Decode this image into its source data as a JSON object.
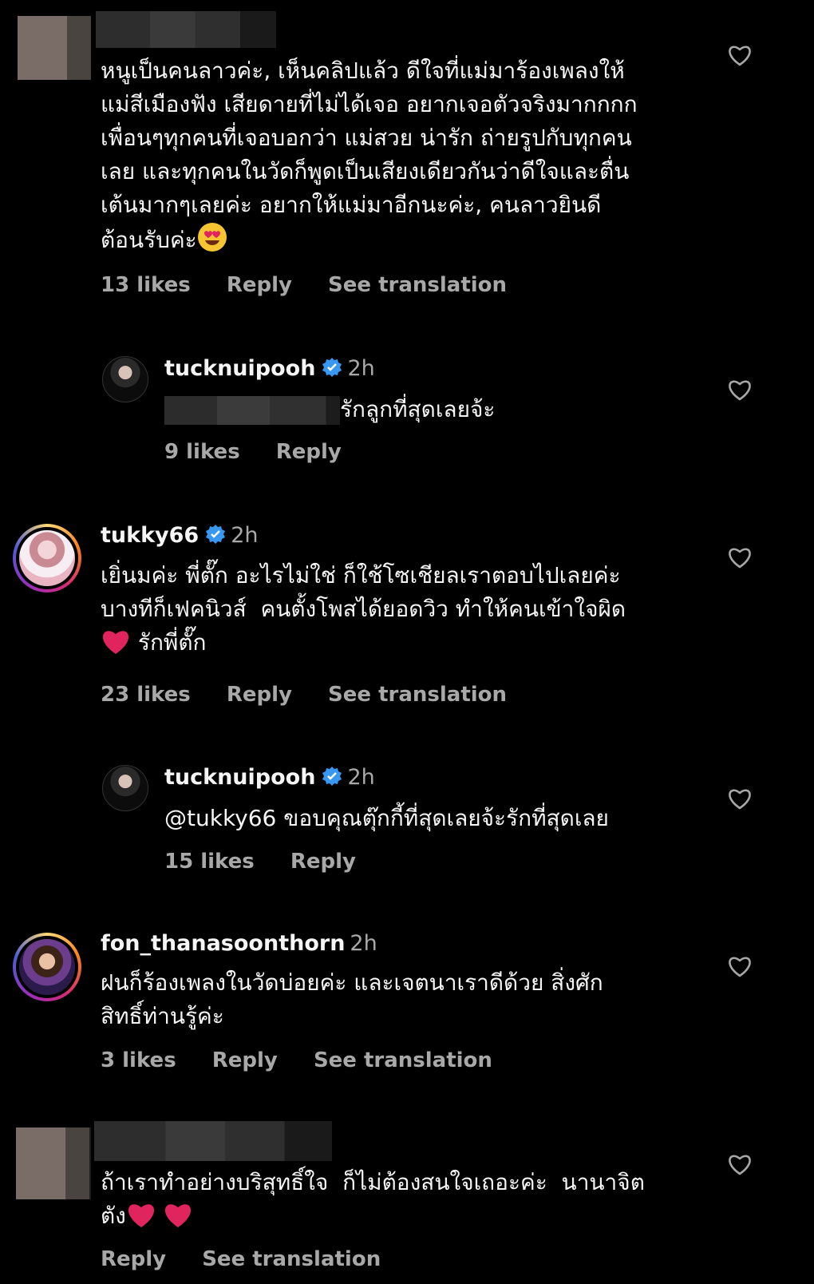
{
  "comments": [
    {
      "text": "หนูเป็นคนลาวค่ะ, เห็นคลิปแล้ว ดีใจที่แม่มาร้องเพลงให้\nแม่สีเมืองฟัง เสียดายที่ไม่ได้เจอ อยากเจอตัวจริงมากกกก\nเพื่อนๆทุกคนที่เจอบอกว่า แม่สวย น่ารัก ถ่ายรูปกับทุกคน\nเลย และทุกคนในวัดก็พูดเป็นเสียงเดียวกันว่าดีใจและตื่น\nเต้นมากๆเลยค่ะ อยากให้แม่มาอีกนะค่ะ, คนลาวยินดี\nต้อนรับค่ะ",
      "likes": "13 likes",
      "reply": "Reply",
      "translate": "See translation"
    },
    {
      "username": "tucknuipooh",
      "time": "2h",
      "text": "รักลูกที่สุดเลยจ้ะ",
      "likes": "9 likes",
      "reply": "Reply"
    },
    {
      "username": "tukky66",
      "time": "2h",
      "text": "เยิ่นมค่ะ พี่ตั๊ก อะไรไม่ใช่ ก็ใช้โซเชียลเราตอบไปเลยค่ะ\nบางทีก็เฟคนิวส์  คนตั้งโพสได้ยอดวิว ทำให้คนเข้าใจผิด",
      "text_tail": "รักพี่ตั๊ก",
      "likes": "23 likes",
      "reply": "Reply",
      "translate": "See translation"
    },
    {
      "username": "tucknuipooh",
      "time": "2h",
      "text": "@tukky66 ขอบคุณตุ๊กกี้ที่สุดเลยจ้ะรักที่สุดเลย",
      "likes": "15 likes",
      "reply": "Reply"
    },
    {
      "username": "fon_thanasoonthorn",
      "time": "2h",
      "text": "ฝนก็ร้องเพลงในวัดบ่อยค่ะ และเจตนาเราดีด้วย สิ่งศัก\nสิทธิ์ท่านรู้ค่ะ",
      "likes": "3 likes",
      "reply": "Reply",
      "translate": "See translation"
    },
    {
      "text": "ถ้าเราทำอย่างบริสุทธิ์ใจ  ก็ไม่ต้องสนใจเถอะค่ะ  นานาจิต\nตัง",
      "reply": "Reply",
      "translate": "See translation"
    }
  ],
  "colors": {
    "background": "#000000",
    "text": "#f5f5f5",
    "secondary": "#a8a8a8",
    "verified": "#3897f0",
    "heart_red": "#e0245e"
  },
  "icons": {
    "like": "heart-outline-icon",
    "verified": "verified-badge-icon",
    "emoji_love": "heart-eyes-emoji",
    "emoji_heart": "red-heart-emoji"
  }
}
